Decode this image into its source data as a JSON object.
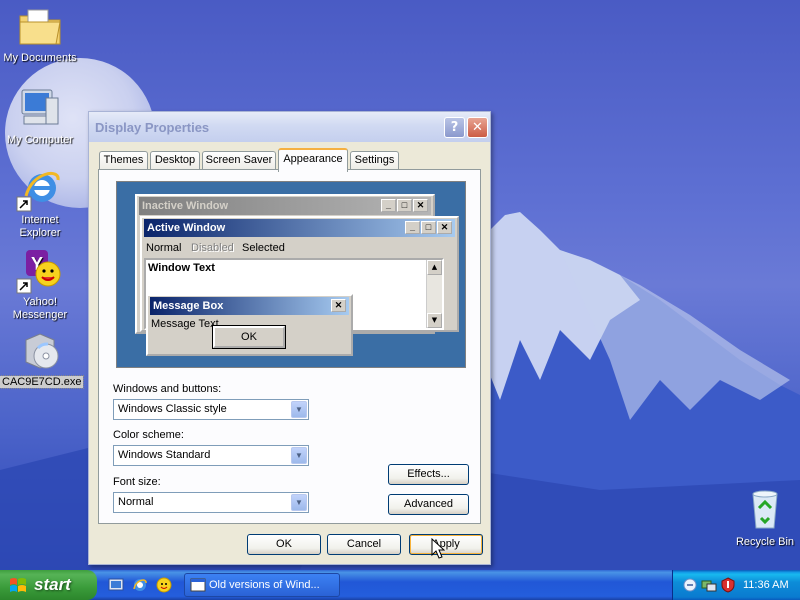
{
  "desktop": {
    "icons": [
      {
        "label": "My Documents"
      },
      {
        "label": "My Computer"
      },
      {
        "label": "Internet Explorer"
      },
      {
        "label": "Yahoo! Messenger"
      },
      {
        "label": "CAC9E7CD.exe"
      },
      {
        "label": "Recycle Bin"
      }
    ]
  },
  "dialog": {
    "title": "Display Properties",
    "help_glyph": "?",
    "close_glyph": "✕",
    "tabs": [
      {
        "label": "Themes"
      },
      {
        "label": "Desktop"
      },
      {
        "label": "Screen Saver"
      },
      {
        "label": "Appearance",
        "active": true
      },
      {
        "label": "Settings"
      }
    ],
    "preview": {
      "inactive_title": "Inactive Window",
      "active_title": "Active Window",
      "menu_normal": "Normal",
      "menu_disabled": "Disabled",
      "menu_selected": "Selected",
      "window_text": "Window Text",
      "message_title": "Message Box",
      "message_text": "Message Text",
      "ok_label": "OK",
      "min_glyph": "_",
      "max_glyph": "□",
      "close_glyph": "✕"
    },
    "windows_buttons": {
      "label": "Windows and buttons:",
      "value": "Windows Classic style"
    },
    "color_scheme": {
      "label": "Color scheme:",
      "value": "Windows Standard"
    },
    "font_size": {
      "label": "Font size:",
      "value": "Normal"
    },
    "effects_label": "Effects...",
    "advanced_label": "Advanced",
    "ok_label": "OK",
    "cancel_label": "Cancel",
    "apply_label": "Apply"
  },
  "taskbar": {
    "start_label": "start",
    "task_label": "Old versions of Wind...",
    "clock": "11:36 AM"
  },
  "colors": {
    "accent": "#245edc",
    "start_green": "#3a9b3a",
    "tab_highlight": "#f5b041",
    "active_caption": "#0a246a",
    "preview_desktop": "#3a6ea5"
  }
}
